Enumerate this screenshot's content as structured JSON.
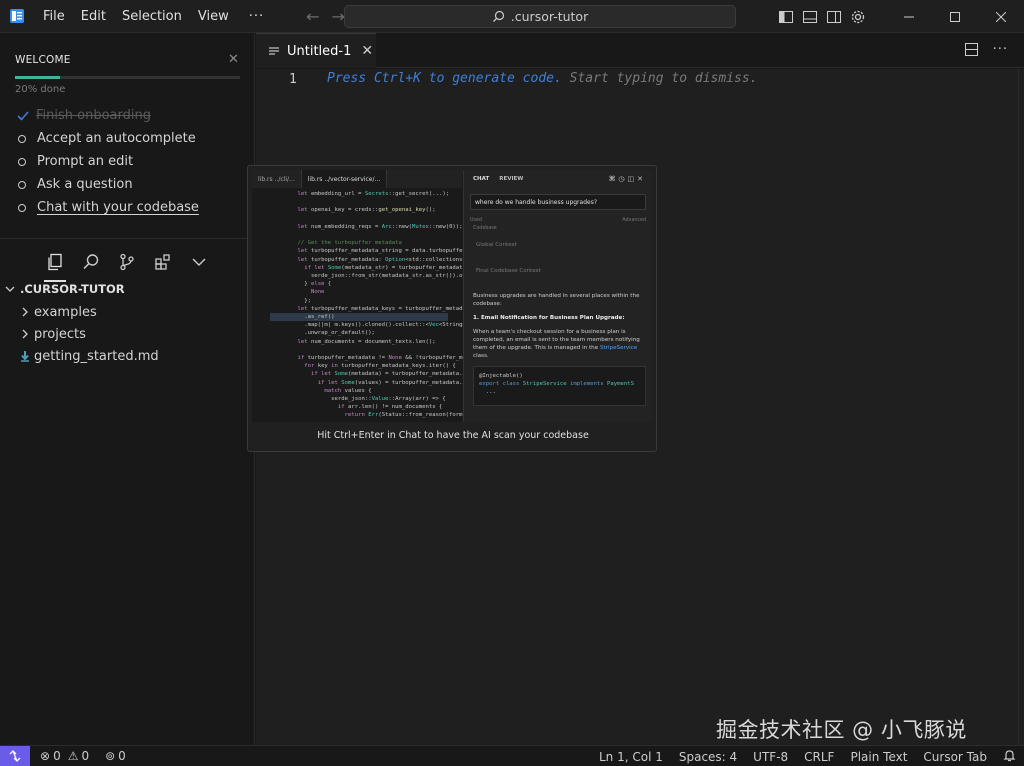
{
  "menu": [
    "File",
    "Edit",
    "Selection",
    "View",
    "···"
  ],
  "search": {
    "text": ".cursor-tutor"
  },
  "welcome": {
    "title": "WELCOME",
    "progress_percent": 20,
    "progress_text": "20% done",
    "steps": [
      {
        "label": "Finish onboarding",
        "done": true
      },
      {
        "label": "Accept an autocomplete",
        "done": false
      },
      {
        "label": "Prompt an edit",
        "done": false
      },
      {
        "label": "Ask a question",
        "done": false
      },
      {
        "label": "Chat with your codebase",
        "done": false
      }
    ]
  },
  "explorer": {
    "root": ".CURSOR-TUTOR",
    "items": [
      {
        "label": "examples",
        "type": "folder"
      },
      {
        "label": "projects",
        "type": "folder"
      },
      {
        "label": "getting_started.md",
        "type": "markdown"
      }
    ]
  },
  "editor": {
    "tab_label": "Untitled-1",
    "line_number": "1",
    "hint_highlight": "Press Ctrl+K to generate code.",
    "hint_rest": " Start typing to dismiss."
  },
  "preview": {
    "code_tab_1": "lib.rs ../cli/...",
    "code_tab_2": "lib.rs ../vector-service/...",
    "chat_tab": "CHAT",
    "review_tab": "REVIEW",
    "question": "where do we handle business upgrades?",
    "opt_used": "Used",
    "opt_advanced": "Advanced",
    "opt_codebase": "Codebase",
    "opt_global": "Global Context",
    "opt_final": "Final Codebase Context",
    "answer_intro": "Business upgrades are handled in several places within the codebase:",
    "answer_heading": "1. Email Notification for Business Plan Upgrade:",
    "answer_body": "When a team's checkout session for a business plan is completed, an email is sent to the team members notifying them of the upgrade. This is managed in the",
    "answer_link": "StripeService",
    "answer_tail": "class.",
    "caption": "Hit Ctrl+Enter in Chat to have the AI scan your codebase"
  },
  "watermark": "掘金技术社区 @ 小飞豚说",
  "status": {
    "errors": "0",
    "warnings": "0",
    "ports": "0",
    "position": "Ln 1, Col 1",
    "spaces": "Spaces: 4",
    "encoding": "UTF-8",
    "eol": "CRLF",
    "language": "Plain Text",
    "cursor_tab": "Cursor Tab"
  },
  "colors": {
    "accent": "#3f7fd6",
    "progress": "#3fb49a",
    "remote": "#6b5ce7"
  },
  "icons": [
    "cursor-logo-icon",
    "search-icon",
    "back-arrow-icon",
    "forward-arrow-icon",
    "toggle-sidebar-icon",
    "toggle-panel-icon",
    "toggle-secondary-sidebar-icon",
    "gear-icon",
    "minimize-icon",
    "maximize-icon",
    "close-icon",
    "files-icon",
    "search-icon",
    "source-control-icon",
    "extensions-icon",
    "chevron-down-icon",
    "split-editor-icon",
    "more-icon",
    "remote-icon",
    "error-icon",
    "warning-icon",
    "broadcast-icon",
    "bell-icon"
  ]
}
